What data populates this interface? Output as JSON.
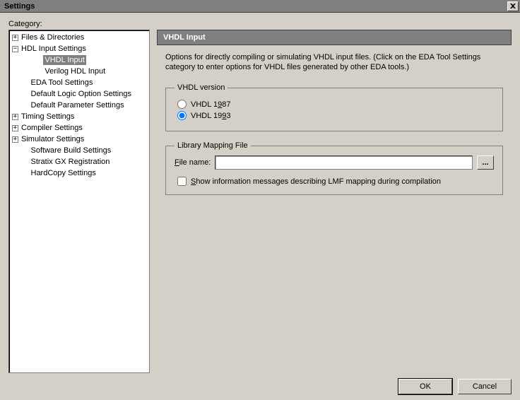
{
  "window": {
    "title": "Settings",
    "close": "×"
  },
  "category_label": "Category:",
  "tree": {
    "files_dirs": "Files & Directories",
    "hdl_input": "HDL Input Settings",
    "vhdl_input": "VHDL Input",
    "verilog_input": "Verilog HDL Input",
    "eda_tool": "EDA Tool Settings",
    "default_logic": "Default Logic Option Settings",
    "default_param": "Default Parameter Settings",
    "timing": "Timing Settings",
    "compiler": "Compiler Settings",
    "simulator": "Simulator Settings",
    "software_build": "Software Build Settings",
    "stratix_gx": "Stratix GX Registration",
    "hardcopy": "HardCopy Settings"
  },
  "panel": {
    "title": "VHDL Input",
    "description": "Options for directly compiling or simulating VHDL input files.  (Click on the EDA Tool Settings category to enter options for VHDL files generated by other EDA tools.)",
    "vhdl_version_legend": "VHDL version",
    "vhdl_1987": "VHDL 1987",
    "vhdl_1993": "VHDL 1993",
    "library_mapping_legend": "Library Mapping File",
    "file_name_label": "File name:",
    "file_name_value": "",
    "browse": "...",
    "show_info": "Show information messages describing LMF mapping during compilation"
  },
  "buttons": {
    "ok": "OK",
    "cancel": "Cancel"
  }
}
